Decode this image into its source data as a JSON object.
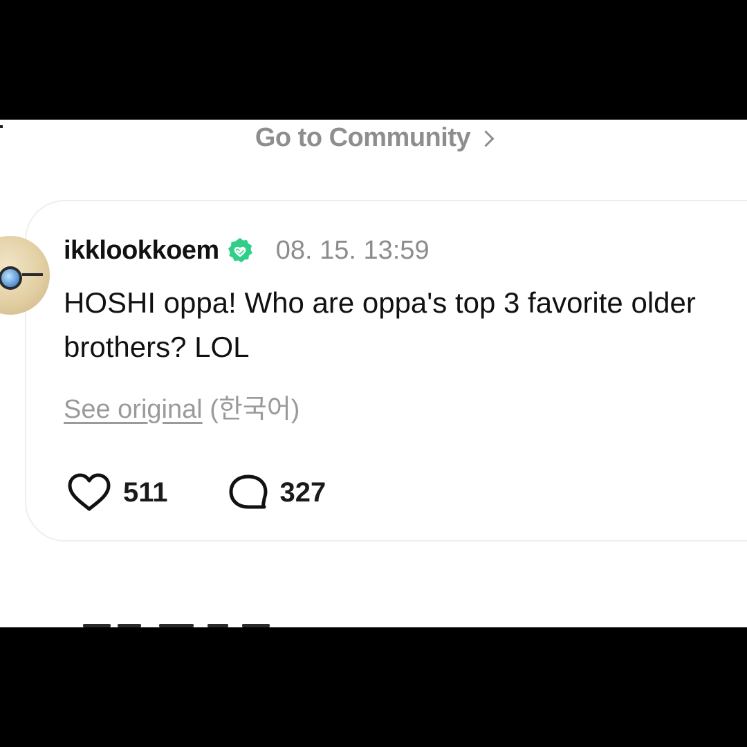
{
  "community_link": {
    "label": "Go to Community"
  },
  "post": {
    "username": "ikklookkoem",
    "verified_badge": "heart-check-icon",
    "timestamp": "08. 15. 13:59",
    "text": "HOSHI oppa! Who are oppa's top 3 favorite older brothers? LOL",
    "see_original_label": "See original",
    "original_language": "(한국어)",
    "likes": "511",
    "comments": "327"
  },
  "colors": {
    "verified_green": "#2fcf8a",
    "muted_text": "#8e8e8e",
    "letterbox": "#000000",
    "card_border": "#eeeeee"
  },
  "icons": {
    "like": "heart-outline-icon",
    "comment": "speech-bubble-icon",
    "chevron": "chevron-right-icon"
  }
}
